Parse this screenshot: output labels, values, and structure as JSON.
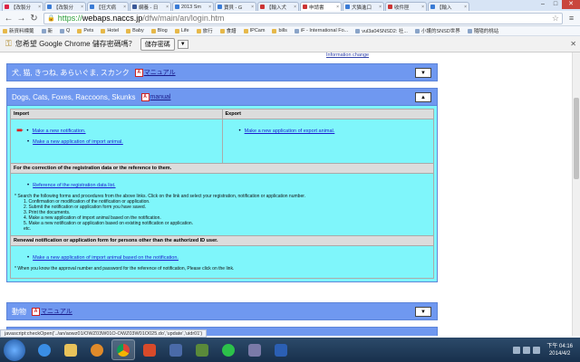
{
  "tabs": [
    {
      "title": "【改製分",
      "color": "#d24",
      "active": false
    },
    {
      "title": "【改製分",
      "color": "#3a7bd5",
      "active": false
    },
    {
      "title": "【狂犬病",
      "color": "#3a7bd5",
      "active": false
    },
    {
      "title": "網養 - 日",
      "color": "#3b5998",
      "active": false
    },
    {
      "title": "2013 Sm",
      "color": "#3a7bd5",
      "active": false
    },
    {
      "title": "寶貝 - G",
      "color": "#3a7bd5",
      "active": false
    },
    {
      "title": "【輸入犬",
      "color": "#c33",
      "active": false
    },
    {
      "title": "申請書",
      "color": "#c33",
      "active": true
    },
    {
      "title": "犬猫進口",
      "color": "#3a7bd5",
      "active": false
    },
    {
      "title": "收件匣",
      "color": "#c33",
      "active": false
    },
    {
      "title": "【輸入",
      "color": "#3a7bd5",
      "active": false
    }
  ],
  "window": {
    "minimize": "–",
    "maximize": "□",
    "close": "✕"
  },
  "toolbar": {
    "url_scheme": "https://",
    "url_host": "webaps.naccs.jp",
    "url_path": "/dfw/main/an/login.htm"
  },
  "bookmarks": [
    {
      "label": "新資料標籤",
      "folder": true
    },
    {
      "label": "新",
      "folder": false
    },
    {
      "label": "Q",
      "folder": false
    },
    {
      "label": "Pets",
      "folder": true
    },
    {
      "label": "Hotel",
      "folder": true
    },
    {
      "label": "Baby",
      "folder": true
    },
    {
      "label": "Blog",
      "folder": true
    },
    {
      "label": "Life",
      "folder": true
    },
    {
      "label": "旅行",
      "folder": true
    },
    {
      "label": "食譜",
      "folder": true
    },
    {
      "label": "IPCam",
      "folder": true
    },
    {
      "label": "bills",
      "folder": true
    },
    {
      "label": "iF - International Fo...",
      "folder": false
    },
    {
      "label": "vul3a04SNSD2: 社...",
      "folder": false
    },
    {
      "label": "小護的SNSD世界",
      "folder": false
    },
    {
      "label": "隨隨的桃站",
      "folder": false
    }
  ],
  "password_bar": {
    "message": "您希望 Google Chrome 儲存密碼嗎？",
    "save_button": "儲存密碼",
    "dropdown": "▼",
    "close": "✕"
  },
  "page": {
    "top_link": "Information change",
    "sections": [
      {
        "title": "犬, 猫, きつね, あらいぐま, スカンク",
        "manual": "マニュアル",
        "toggle": "▼"
      },
      {
        "title": "Dogs, Cats, Foxes, Raccoons, Skunks",
        "manual": "manual",
        "toggle": "▲",
        "import_head": "Import",
        "export_head": "Export",
        "import_links": [
          "Make a new notification.",
          "Make a new application of import animal."
        ],
        "export_links": [
          "Make a new application of export animal."
        ],
        "correction_head": "For the correction of the registration data or the reference to them.",
        "correction_link": "Reference of the registration data list.",
        "correction_note": "* Search the following forms and procedures from the above links. Click on the link and select your registration, notification or application number.",
        "correction_steps": [
          "1. Confirmation or modification of the notification or application.",
          "2. Submit the notification or application form you have saved.",
          "3. Print the documents.",
          "4. Make a new application of import animal based on the notification.",
          "5. Make a new notification or application based on existing notification or application.",
          "etc."
        ],
        "renewal_head": "Renewal notification or application form for persons other than the authorized ID user.",
        "renewal_link": "Make a new application of import animal based on the notification.",
        "renewal_note": "* When you know the approval number and password for the reference of notification, Please click on the link."
      },
      {
        "title": "動物",
        "manual": "マニュアル",
        "toggle": "▼"
      }
    ]
  },
  "status_text": "javascript:checkOpen('../an/aowz01/OWZ03W01O-OWZ03W01O025.do','update','uidr01')",
  "tray": {
    "time": "下午 04:16",
    "date": "2014/4/2"
  }
}
